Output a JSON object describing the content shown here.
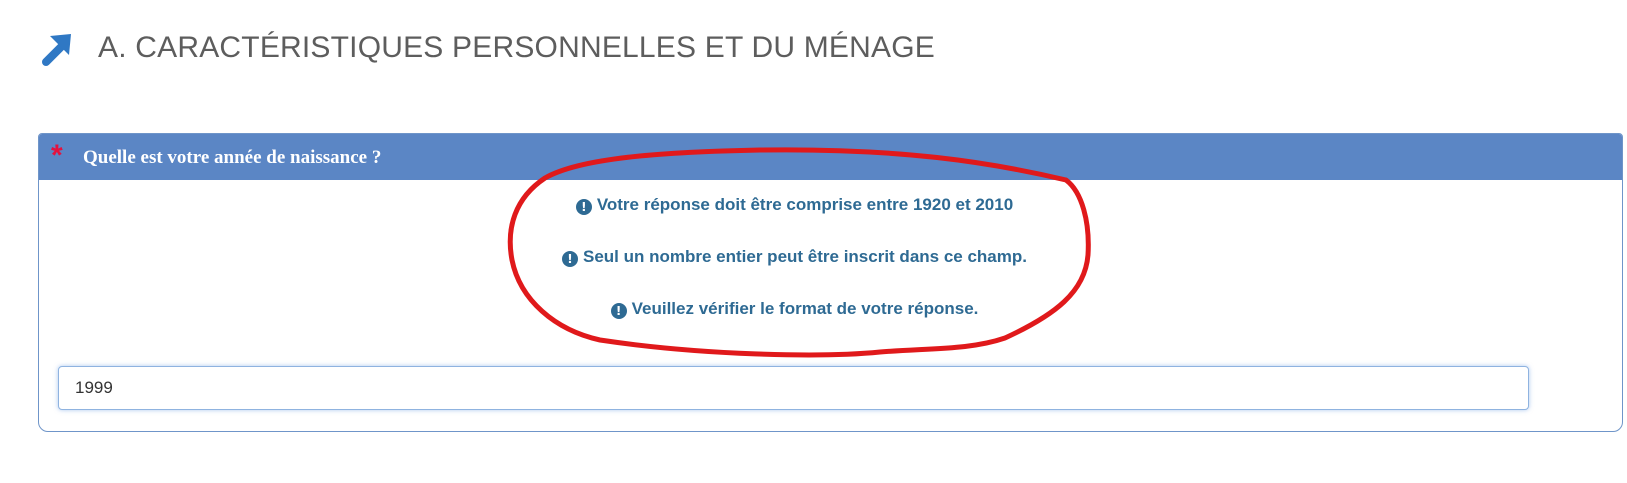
{
  "section": {
    "icon": "arrow-up-right-icon",
    "title": "A. CARACTÉRISTIQUES PERSONNELLES ET DU MÉNAGE"
  },
  "question": {
    "required_marker": "*",
    "text": "Quelle est votre année de naissance ?",
    "errors": [
      "Votre réponse doit être comprise entre 1920 et 2010",
      "Seul un nombre entier peut être inscrit dans ce champ.",
      "Veuillez vérifier le format de votre réponse."
    ],
    "answer_value": "1999"
  },
  "colors": {
    "accent_blue": "#5b86c5",
    "error_text": "#2e6a93",
    "required_red": "#e4123f",
    "annotation_red": "#e0191b"
  }
}
